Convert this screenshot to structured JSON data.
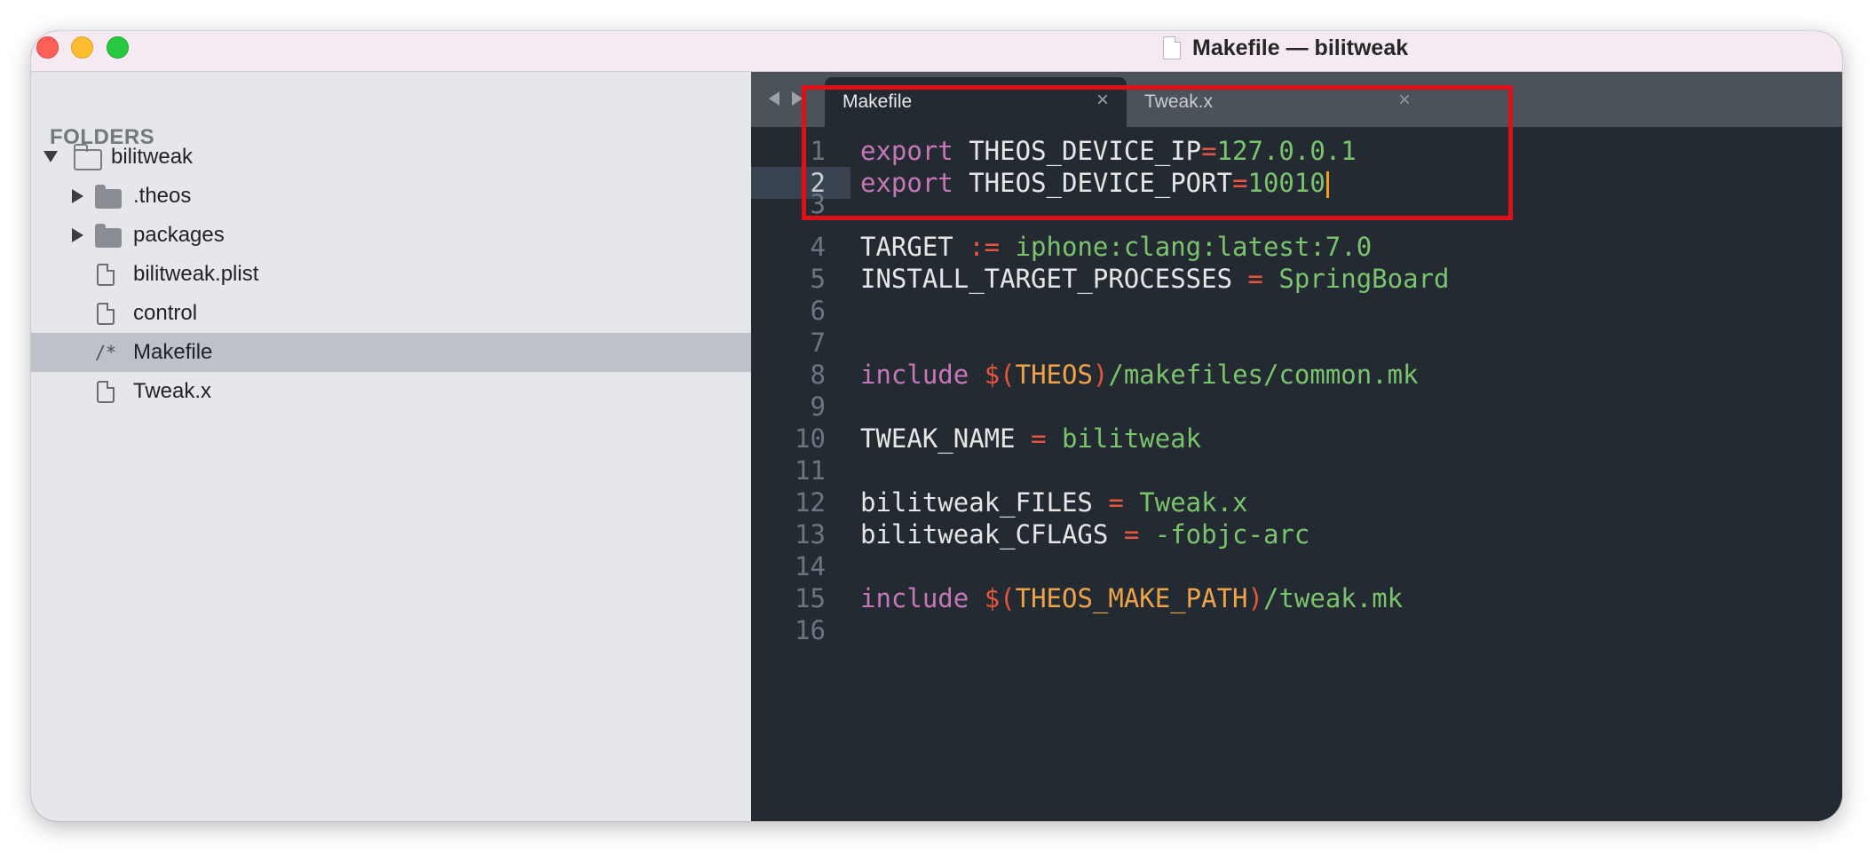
{
  "window": {
    "title": "Makefile — bilitweak"
  },
  "sidebar": {
    "heading": "FOLDERS",
    "root": {
      "label": "bilitweak"
    },
    "items": [
      {
        "label": ".theos",
        "type": "folder"
      },
      {
        "label": "packages",
        "type": "folder"
      },
      {
        "label": "bilitweak.plist",
        "type": "file"
      },
      {
        "label": "control",
        "type": "file"
      },
      {
        "label": "Makefile",
        "type": "makefile",
        "selected": true,
        "icon_text": "/*"
      },
      {
        "label": "Tweak.x",
        "type": "file"
      }
    ]
  },
  "tabs": [
    {
      "label": "Makefile",
      "active": true,
      "close": "×"
    },
    {
      "label": "Tweak.x",
      "active": false,
      "close": "×"
    }
  ],
  "editor": {
    "current_line": 2,
    "lines": [
      {
        "num": "1",
        "parts": [
          [
            "kw",
            "export"
          ],
          [
            "var",
            " THEOS_DEVICE_IP"
          ],
          [
            "op",
            "="
          ],
          [
            "str",
            "127.0.0.1"
          ]
        ]
      },
      {
        "num": "2",
        "parts": [
          [
            "kw",
            "export"
          ],
          [
            "var",
            " THEOS_DEVICE_PORT"
          ],
          [
            "op",
            "="
          ],
          [
            "str",
            "10010"
          ]
        ]
      },
      {
        "num": "3",
        "parts": []
      },
      {
        "num": "4",
        "parts": [
          [
            "var",
            "TARGET "
          ],
          [
            "op",
            ":="
          ],
          [
            "str",
            " iphone:clang:latest:7.0"
          ]
        ]
      },
      {
        "num": "5",
        "parts": [
          [
            "var",
            "INSTALL_TARGET_PROCESSES "
          ],
          [
            "op",
            "="
          ],
          [
            "str",
            " SpringBoard"
          ]
        ]
      },
      {
        "num": "6",
        "parts": []
      },
      {
        "num": "7",
        "parts": []
      },
      {
        "num": "8",
        "parts": [
          [
            "kw",
            "include"
          ],
          [
            "var",
            " "
          ],
          [
            "paren",
            "$("
          ],
          [
            "mac",
            "THEOS"
          ],
          [
            "paren",
            ")"
          ],
          [
            "str",
            "/makefiles/common.mk"
          ]
        ]
      },
      {
        "num": "9",
        "parts": []
      },
      {
        "num": "10",
        "parts": [
          [
            "var",
            "TWEAK_NAME "
          ],
          [
            "op",
            "="
          ],
          [
            "str",
            " bilitweak"
          ]
        ]
      },
      {
        "num": "11",
        "parts": []
      },
      {
        "num": "12",
        "parts": [
          [
            "var",
            "bilitweak_FILES "
          ],
          [
            "op",
            "="
          ],
          [
            "str",
            " Tweak.x"
          ]
        ]
      },
      {
        "num": "13",
        "parts": [
          [
            "var",
            "bilitweak_CFLAGS "
          ],
          [
            "op",
            "="
          ],
          [
            "str",
            " -fobjc-arc"
          ]
        ]
      },
      {
        "num": "14",
        "parts": []
      },
      {
        "num": "15",
        "parts": [
          [
            "kw",
            "include"
          ],
          [
            "var",
            " "
          ],
          [
            "paren",
            "$("
          ],
          [
            "mac",
            "THEOS_MAKE_PATH"
          ],
          [
            "paren",
            ")"
          ],
          [
            "str",
            "/tweak.mk"
          ]
        ]
      },
      {
        "num": "16",
        "parts": []
      }
    ]
  },
  "colors": {
    "keyword": "#c678b6",
    "operator": "#e8553e",
    "string": "#7cc36e",
    "macro": "#f0a44a",
    "highlight_box": "#e0101a"
  }
}
